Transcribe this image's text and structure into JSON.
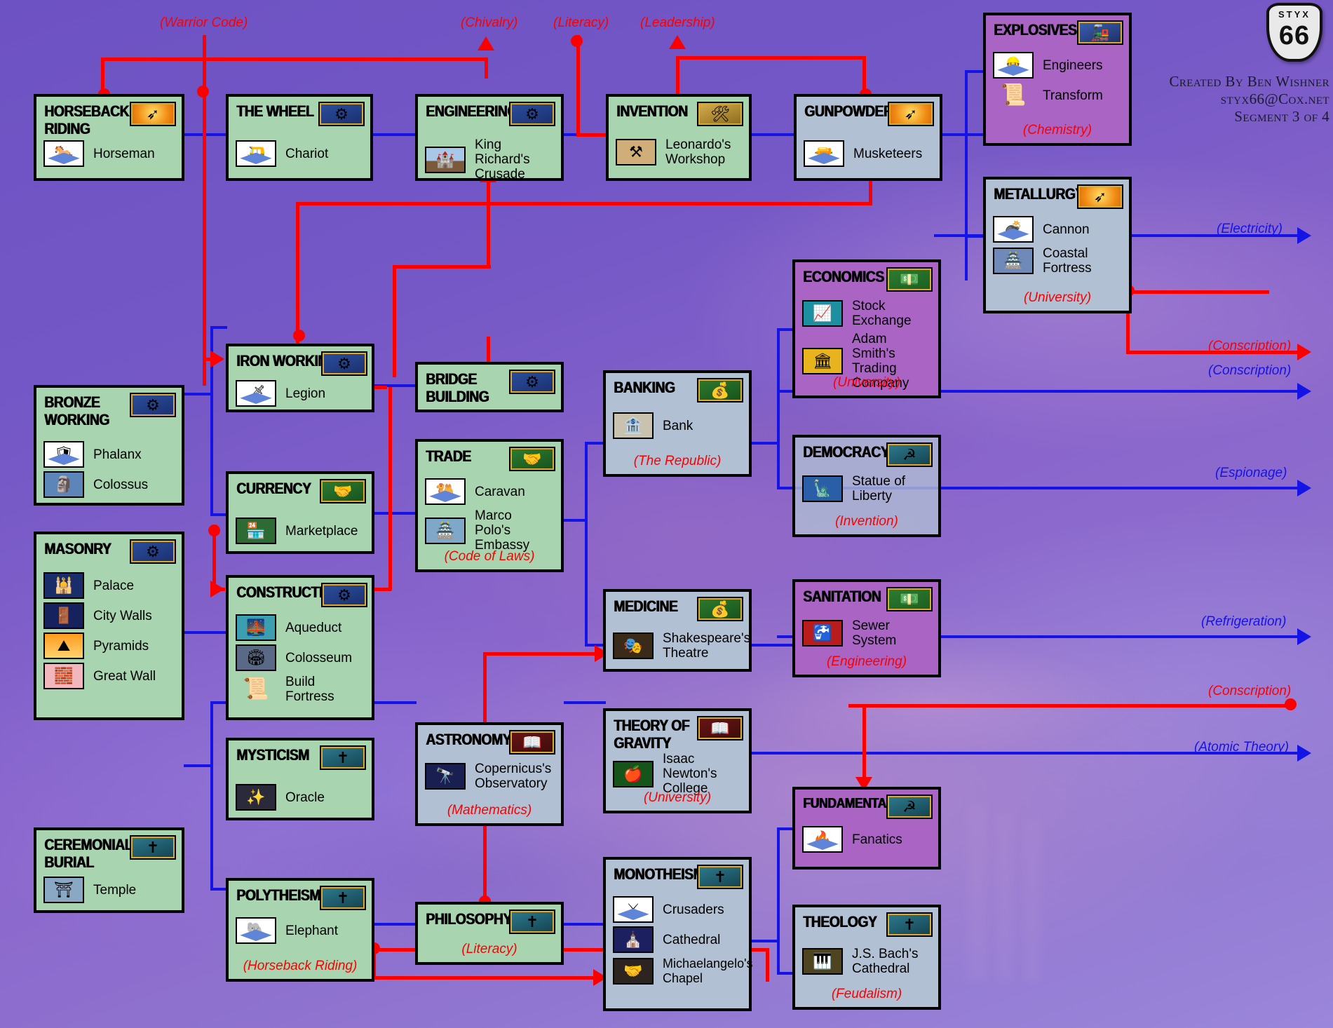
{
  "meta": {
    "logo_top": "STYX",
    "logo_num": "66",
    "credit_line1": "Created By Ben Wishner",
    "credit_line2": "styx66@Cox.net",
    "credit_line3": "Segment 3 of 4"
  },
  "top_labels": [
    {
      "text": "(Warrior Code)"
    },
    {
      "text": "(Chivalry)"
    },
    {
      "text": "(Literacy)"
    },
    {
      "text": "(Leadership)"
    }
  ],
  "right_labels": [
    {
      "text": "(Electricity)"
    },
    {
      "text": "(Conscription)"
    },
    {
      "text": "(Conscription)"
    },
    {
      "text": "(Espionage)"
    },
    {
      "text": "(Refrigeration)"
    },
    {
      "text": "(Conscription)"
    },
    {
      "text": "(Atomic Theory)"
    }
  ],
  "techs": [
    {
      "id": "horseback-riding",
      "name": "HORSEBACK RIDING",
      "adv": "military-arrow-icon",
      "items": [
        {
          "label": "Horseman",
          "icon": "horseman-unit-icon"
        }
      ],
      "req": ""
    },
    {
      "id": "the-wheel",
      "name": "THE WHEEL",
      "adv": "bronze-cart-icon",
      "items": [
        {
          "label": "Chariot",
          "icon": "chariot-unit-icon"
        }
      ],
      "req": ""
    },
    {
      "id": "engineering",
      "name": "ENGINEERING",
      "adv": "bronze-cart-icon",
      "items": [
        {
          "label": "King Richard's Crusade",
          "icon": "king-richards-crusade-icon"
        }
      ],
      "req": ""
    },
    {
      "id": "invention",
      "name": "INVENTION",
      "adv": "gold-cart-icon",
      "items": [
        {
          "label": "Leonardo's Workshop",
          "icon": "leonardos-workshop-icon"
        }
      ],
      "req": ""
    },
    {
      "id": "gunpowder",
      "name": "GUNPOWDER",
      "adv": "military-arrow-icon",
      "items": [
        {
          "label": "Musketeers",
          "icon": "musketeers-unit-icon"
        }
      ],
      "req": ""
    },
    {
      "id": "explosives",
      "name": "EXPLOSIVES",
      "adv": "train-icon",
      "items": [
        {
          "label": "Engineers",
          "icon": "engineers-unit-icon"
        },
        {
          "label": "Transform",
          "icon": "scroll-icon"
        }
      ],
      "req": "(Chemistry)"
    },
    {
      "id": "metallurgy",
      "name": "METALLURGY",
      "adv": "military-arrow-icon",
      "items": [
        {
          "label": "Cannon",
          "icon": "cannon-unit-icon"
        },
        {
          "label": "Coastal Fortress",
          "icon": "coastal-fortress-icon"
        }
      ],
      "req": "(University)"
    },
    {
      "id": "iron-working",
      "name": "IRON WORKING",
      "adv": "bronze-cart-icon",
      "items": [
        {
          "label": "Legion",
          "icon": "legion-unit-icon"
        }
      ],
      "req": ""
    },
    {
      "id": "bridge-building",
      "name": "BRIDGE BUILDING",
      "adv": "bronze-cart-icon",
      "items": [],
      "req": ""
    },
    {
      "id": "banking",
      "name": "BANKING",
      "adv": "gold-coins-icon",
      "items": [
        {
          "label": "Bank",
          "icon": "bank-icon"
        }
      ],
      "req": "(The Republic)"
    },
    {
      "id": "economics",
      "name": "ECONOMICS",
      "adv": "banknote-icon",
      "items": [
        {
          "label": "Stock Exchange",
          "icon": "stock-exchange-icon"
        },
        {
          "label": "Adam Smith's Trading Company",
          "icon": "adam-smith-icon"
        }
      ],
      "req": "(University)"
    },
    {
      "id": "democracy",
      "name": "DEMOCRACY",
      "adv": "hammer-sickle-icon",
      "items": [
        {
          "label": "Statue of Liberty",
          "icon": "statue-of-liberty-icon"
        }
      ],
      "req": "(Invention)"
    },
    {
      "id": "bronze-working",
      "name": "BRONZE WORKING",
      "adv": "bronze-cart-icon",
      "items": [
        {
          "label": "Phalanx",
          "icon": "phalanx-unit-icon"
        },
        {
          "label": "Colossus",
          "icon": "colossus-icon"
        }
      ],
      "req": ""
    },
    {
      "id": "currency",
      "name": "CURRENCY",
      "adv": "trade-hand-icon",
      "items": [
        {
          "label": "Marketplace",
          "icon": "marketplace-icon"
        }
      ],
      "req": ""
    },
    {
      "id": "trade",
      "name": "TRADE",
      "adv": "trade-hand-icon",
      "items": [
        {
          "label": "Caravan",
          "icon": "caravan-unit-icon"
        },
        {
          "label": "Marco Polo's Embassy",
          "icon": "marco-polo-icon"
        }
      ],
      "req": "(Code of Laws)"
    },
    {
      "id": "masonry",
      "name": "MASONRY",
      "adv": "bronze-cart-icon",
      "items": [
        {
          "label": "Palace",
          "icon": "palace-icon"
        },
        {
          "label": "City Walls",
          "icon": "city-walls-icon"
        },
        {
          "label": "Pyramids",
          "icon": "pyramids-icon"
        },
        {
          "label": "Great Wall",
          "icon": "great-wall-icon"
        }
      ],
      "req": ""
    },
    {
      "id": "construction",
      "name": "CONSTRUCTION",
      "adv": "bronze-cart-icon",
      "items": [
        {
          "label": "Aqueduct",
          "icon": "aqueduct-icon"
        },
        {
          "label": "Colosseum",
          "icon": "colosseum-icon"
        },
        {
          "label": "Build Fortress",
          "icon": "scroll-icon"
        }
      ],
      "req": ""
    },
    {
      "id": "medicine",
      "name": "MEDICINE",
      "adv": "gold-coins-icon",
      "items": [
        {
          "label": "Shakespeare's Theatre",
          "icon": "shakespeare-icon"
        }
      ],
      "req": ""
    },
    {
      "id": "sanitation",
      "name": "SANITATION",
      "adv": "banknote-icon",
      "items": [
        {
          "label": "Sewer System",
          "icon": "sewer-system-icon"
        }
      ],
      "req": "(Engineering)"
    },
    {
      "id": "mysticism",
      "name": "MYSTICISM",
      "adv": "cross-icon",
      "items": [
        {
          "label": "Oracle",
          "icon": "oracle-icon"
        }
      ],
      "req": ""
    },
    {
      "id": "astronomy",
      "name": "ASTRONOMY",
      "adv": "book-icon",
      "items": [
        {
          "label": "Copernicus's Observatory",
          "icon": "copernicus-icon"
        }
      ],
      "req": "(Mathematics)"
    },
    {
      "id": "theory-of-gravity",
      "name": "THEORY OF GRAVITY",
      "adv": "book-icon",
      "items": [
        {
          "label": "Isaac Newton's College",
          "icon": "newton-apple-icon"
        }
      ],
      "req": "(University)"
    },
    {
      "id": "fundamentalism",
      "name": "FUNDAMENTALISM",
      "adv": "hammer-sickle-icon",
      "items": [
        {
          "label": "Fanatics",
          "icon": "fanatics-unit-icon"
        }
      ],
      "req": ""
    },
    {
      "id": "ceremonial-burial",
      "name": "CEREMONIAL BURIAL",
      "adv": "cross-icon",
      "items": [
        {
          "label": "Temple",
          "icon": "temple-icon"
        }
      ],
      "req": ""
    },
    {
      "id": "polytheism",
      "name": "POLYTHEISM",
      "adv": "cross-icon",
      "items": [
        {
          "label": "Elephant",
          "icon": "elephant-unit-icon"
        }
      ],
      "req": "(Horseback Riding)"
    },
    {
      "id": "philosophy",
      "name": "PHILOSOPHY",
      "adv": "cross-icon",
      "items": [],
      "req": "(Literacy)"
    },
    {
      "id": "monotheism",
      "name": "MONOTHEISM",
      "adv": "cross-icon",
      "items": [
        {
          "label": "Crusaders",
          "icon": "crusaders-unit-icon"
        },
        {
          "label": "Cathedral",
          "icon": "cathedral-icon"
        },
        {
          "label": "Michaelangelo's Chapel",
          "icon": "michaelangelo-icon"
        }
      ],
      "req": ""
    },
    {
      "id": "theology",
      "name": "THEOLOGY",
      "adv": "cross-icon",
      "items": [
        {
          "label": "J.S. Bach's Cathedral",
          "icon": "bach-cathedral-icon"
        }
      ],
      "req": "(Feudalism)"
    }
  ]
}
